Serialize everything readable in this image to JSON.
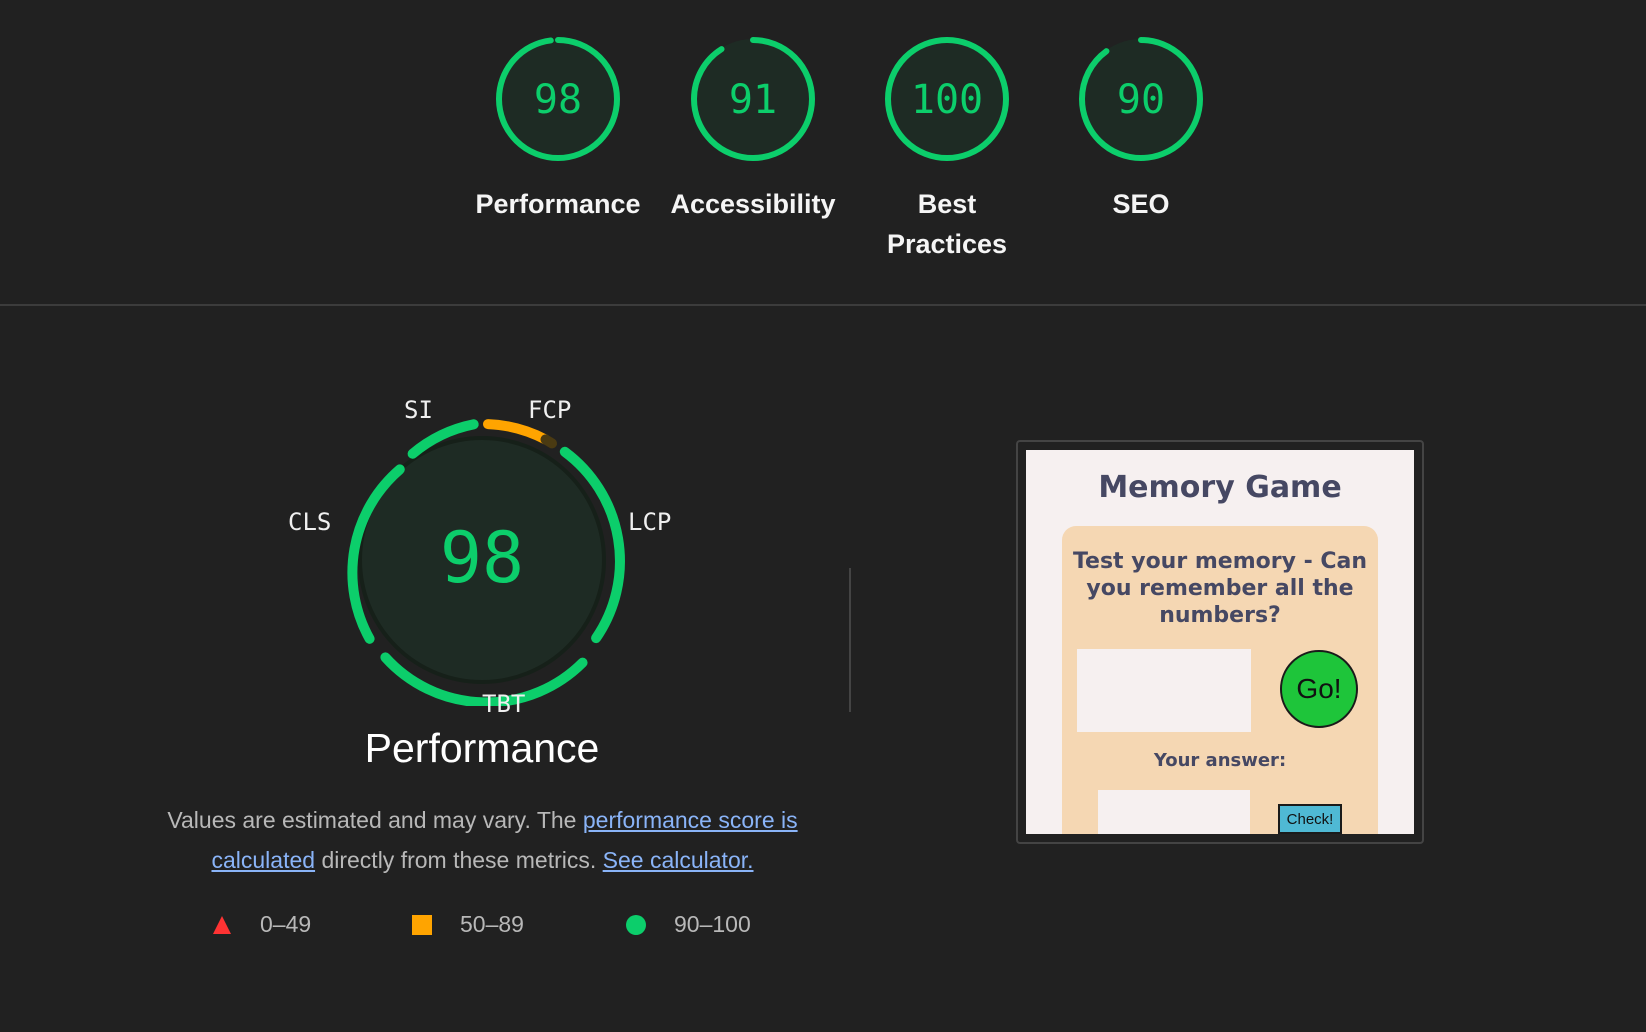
{
  "summary": {
    "gauges": [
      {
        "score": "98",
        "label": "Performance",
        "value": 98
      },
      {
        "score": "91",
        "label": "Accessibility",
        "value": 91
      },
      {
        "score": "100",
        "label": "Best Practices",
        "value": 100
      },
      {
        "score": "90",
        "label": "SEO",
        "value": 90
      }
    ]
  },
  "performance": {
    "score": "98",
    "title": "Performance",
    "metrics": {
      "si": "SI",
      "fcp": "FCP",
      "lcp": "LCP",
      "tbt": "TBT",
      "cls": "CLS"
    },
    "description": {
      "part1": "Values are estimated and may vary. The ",
      "link1": "performance score is calculated",
      "part2": " directly from these metrics. ",
      "link2": "See calculator."
    },
    "legend": [
      {
        "range": "0–49",
        "shape": "triangle",
        "color": "#ff3333"
      },
      {
        "range": "50–89",
        "shape": "square",
        "color": "#ffa400"
      },
      {
        "range": "90–100",
        "shape": "circle",
        "color": "#0cce6b"
      }
    ]
  },
  "colors": {
    "pass": "#0cce6b",
    "average": "#ffa400",
    "fail": "#ff3333",
    "gauge_bg": "#1e2b24",
    "link": "#8ab4f8"
  },
  "screenshot": {
    "title": "Memory Game",
    "prompt": "Test your memory - Can you remember all the numbers?",
    "go_button": "Go!",
    "answer_label": "Your answer:",
    "check_button": "Check!"
  }
}
